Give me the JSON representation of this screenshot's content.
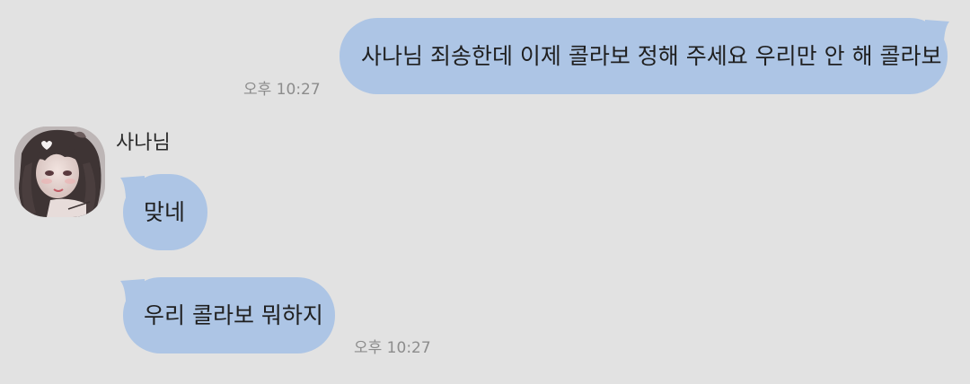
{
  "messages": [
    {
      "direction": "outgoing",
      "text": "사나님 죄송한데 이제 콜라보 정해 주세요 우리만 안 해 콜라보",
      "time": "오후 10:27"
    },
    {
      "direction": "incoming",
      "sender": "사나님",
      "text": "맞네"
    },
    {
      "direction": "incoming",
      "text": "우리 콜라보 뭐하지",
      "time": "오후 10:27"
    }
  ],
  "colors": {
    "background": "#e2e2e2",
    "bubble": "#adc5e5",
    "text": "#1f1f1f",
    "timestamp": "#8c8c8c"
  },
  "icons": {
    "avatar": "profile-photo-anime-girl"
  }
}
